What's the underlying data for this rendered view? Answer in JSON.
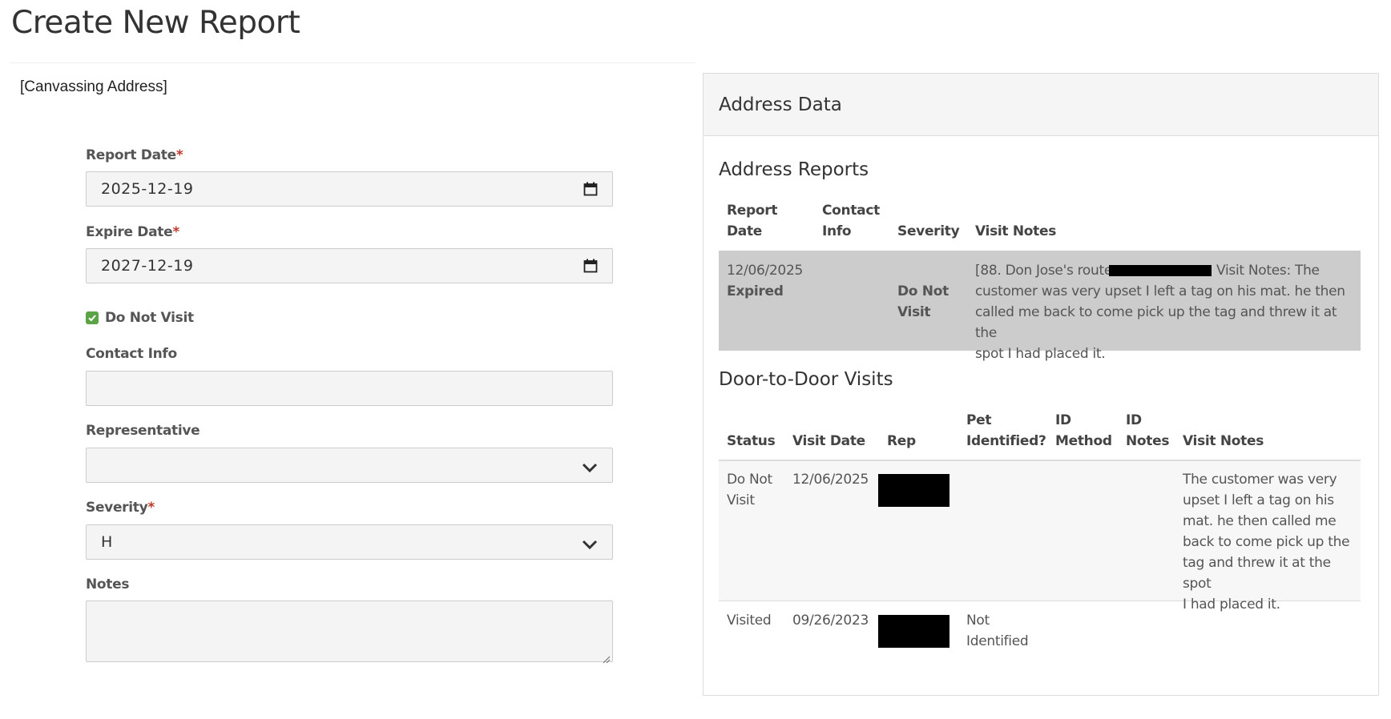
{
  "page": {
    "title": "Create New Report",
    "canvassing_address": "[Canvassing Address]"
  },
  "form": {
    "report_date": {
      "label": "Report Date",
      "required_mark": "*",
      "value": "2025-12-19"
    },
    "expire_date": {
      "label": "Expire Date",
      "required_mark": "*",
      "value": "2027-12-19"
    },
    "do_not_visit": {
      "label": "Do Not Visit",
      "checked": true
    },
    "contact_info": {
      "label": "Contact Info",
      "value": ""
    },
    "representative": {
      "label": "Representative",
      "value": ""
    },
    "severity": {
      "label": "Severity",
      "required_mark": "*",
      "value": "H"
    },
    "notes": {
      "label": "Notes",
      "value": ""
    }
  },
  "address_data": {
    "title": "Address Data",
    "reports": {
      "title": "Address Reports",
      "headers": {
        "report_date_1": "Report",
        "report_date_2": "Date",
        "contact_info_1": "Contact",
        "contact_info_2": "Info",
        "severity": "Severity",
        "visit_notes": "Visit Notes"
      },
      "rows": [
        {
          "date": "12/06/2025",
          "status": "Expired",
          "contact_info": "",
          "severity_1": "Do Not",
          "severity_2": "Visit",
          "notes_line1_a": "[88. Don Jose's route",
          "notes_line1_b": "Visit Notes: The",
          "notes_line2": "customer was very upset I left a tag on his mat. he then",
          "notes_line3": "called me back to come pick up the tag and threw it at the",
          "notes_line4": "spot I had placed it."
        }
      ]
    },
    "visits": {
      "title": "Door-to-Door Visits",
      "headers": {
        "status": "Status",
        "visit_date": "Visit Date",
        "rep": "Rep",
        "pet_1": "Pet",
        "pet_2": "Identified?",
        "id_method_1": "ID",
        "id_method_2": "Method",
        "id_notes_1": "ID",
        "id_notes_2": "Notes",
        "visit_notes": "Visit Notes"
      },
      "rows": [
        {
          "status_1": "Do Not",
          "status_2": "Visit",
          "visit_date": "12/06/2025",
          "pet_identified": "",
          "notes": [
            "The customer was very",
            "upset I left a tag on his",
            "mat. he then called me",
            "back to come pick up the",
            "tag and threw it at the spot",
            "I had placed it."
          ]
        },
        {
          "status_1": "Visited",
          "visit_date": "09/26/2023",
          "pet_1": "Not",
          "pet_2": "Identified"
        }
      ]
    }
  },
  "colors": {
    "checkbox": "#5aa445",
    "required": "#c0392b",
    "report_row_bg": "#cccccc"
  }
}
